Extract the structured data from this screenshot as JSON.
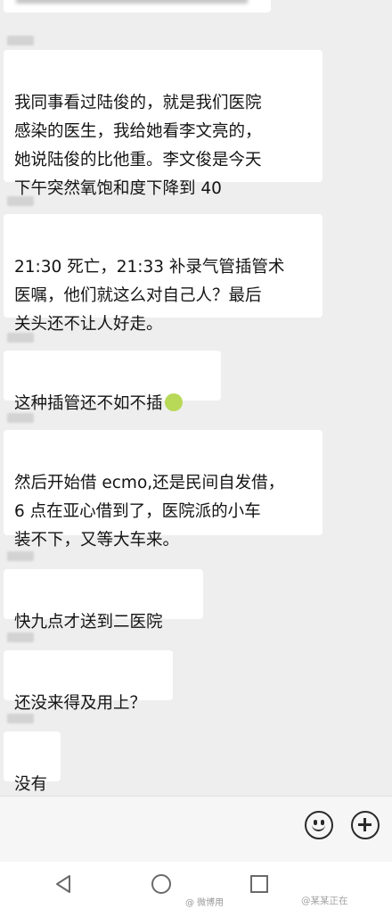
{
  "messages": [
    {
      "text": "我同事看过陆俊的，就是我们医院\n感染的医生，我给她看李文亮的，\n她说陆俊的比他重。李文俊是今天\n下午突然氧饱和度下降到 40"
    },
    {
      "text": "21:30 死亡，21:33 补录气管插管术\n医嘱，他们就这么对自己人？最后\n关头还不让人好走。"
    },
    {
      "text": "这种插管还不如不插",
      "emoji": "nauseated-face-icon"
    },
    {
      "text": "然后开始借 ecmo,还是民间自发借，\n6 点在亚心借到了，医院派的小车\n装不下，又等大车来。"
    },
    {
      "text": "快九点才送到二医院"
    },
    {
      "text": "还没来得及用上？"
    },
    {
      "text": "没有"
    }
  ],
  "input_bar": {
    "emoji_button_icon": "smiley-face-icon",
    "plus_button_icon": "plus-circle-icon"
  },
  "nav_bar": {
    "back_icon": "triangle-back-icon",
    "home_icon": "circle-home-icon",
    "recent_icon": "square-recent-apps-icon"
  },
  "watermarks": {
    "left": "@ 微博用",
    "right": "@某某正在"
  },
  "colors": {
    "chat_background": "#eeeeee",
    "bubble_background": "#ffffff",
    "emoji_green": "#b7d957"
  }
}
